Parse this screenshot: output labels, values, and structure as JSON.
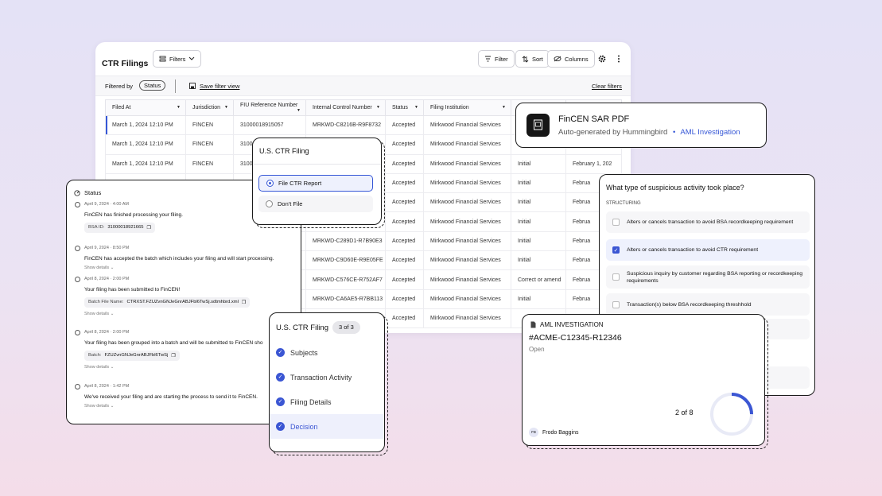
{
  "table_card": {
    "title": "CTR Filings",
    "filters_btn": "Filters",
    "filter_btn": "Filter",
    "sort_btn": "Sort",
    "columns_btn": "Columns",
    "filtered_by": "Filtered by",
    "status_pill": "Status",
    "save_view": "Save filter view",
    "clear_filters": "Clear filters",
    "columns": [
      "Filed At",
      "Jurisdiction",
      "FIU Reference Number",
      "Internal Control Number",
      "Status",
      "Filing Institution",
      "",
      ""
    ],
    "rows": [
      [
        "March 1, 2024 12:10 PM",
        "FINCEN",
        "31000018915057",
        "MRKWD-C8216B-R9F8732",
        "Accepted",
        "Mirkwood Financial Services",
        "",
        ""
      ],
      [
        "March 1, 2024 12:10 PM",
        "FINCEN",
        "3100",
        "",
        "Accepted",
        "Mirkwood Financial Services",
        "",
        ""
      ],
      [
        "March 1, 2024 12:10 PM",
        "FINCEN",
        "3100",
        "",
        "Accepted",
        "Mirkwood Financial Services",
        "Initial",
        "February 1, 202"
      ],
      [
        "",
        "",
        "",
        "",
        "Accepted",
        "Mirkwood Financial Services",
        "Initial",
        "Februa"
      ],
      [
        "",
        "",
        "",
        "",
        "Accepted",
        "Mirkwood Financial Services",
        "Initial",
        "Februa"
      ],
      [
        "",
        "",
        "",
        "",
        "Accepted",
        "Mirkwood Financial Services",
        "Initial",
        "Februa"
      ],
      [
        "",
        "",
        "",
        "MRKWD-C289D1-R7B90E3",
        "Accepted",
        "Mirkwood Financial Services",
        "Initial",
        "Februa"
      ],
      [
        "",
        "",
        "",
        "MRKWD-C9D60E-R9E05FE",
        "Accepted",
        "Mirkwood Financial Services",
        "Initial",
        "Februa"
      ],
      [
        "",
        "",
        "",
        "MRKWD-C576CE-R752AF7",
        "Accepted",
        "Mirkwood Financial Services",
        "Correct or amend",
        "Februa"
      ],
      [
        "",
        "",
        "",
        "MRKWD-CA6AE5-R7BB113",
        "Accepted",
        "Mirkwood Financial Services",
        "Initial",
        "Februa"
      ],
      [
        "",
        "",
        "",
        "",
        "Accepted",
        "Mirkwood Financial Services",
        "",
        ""
      ]
    ]
  },
  "status_card": {
    "title": "Status",
    "events": [
      {
        "date": "April 9, 2024 · 4:00 AM",
        "text": "FinCEN has finished processing your filing.",
        "chip_label": "BSA ID:",
        "chip_value": "31000018921665",
        "details": ""
      },
      {
        "date": "April 9, 2024 · 8:50 PM",
        "text": "FinCEN has accepted the batch which includes your filing and will start processing.",
        "chip_label": "",
        "chip_value": "",
        "details": "Show details"
      },
      {
        "date": "April 8, 2024 · 2:00 PM",
        "text": "Your filing has been submitted to FinCEN!",
        "chip_label": "Batch File Name:",
        "chip_value": "CTRXST.FZUZvnGNJeGnrABJFbl6TwSj.sdtmhbrd.xml",
        "details": "Show details"
      },
      {
        "date": "April 8, 2024 · 2:00 PM",
        "text": "Your filing has been grouped into a batch and will be submitted to FinCEN sho",
        "chip_label": "Batch:",
        "chip_value": "FZUZvnGNJeGnrABJFbl6TwSj",
        "details": "Show details"
      },
      {
        "date": "April 8, 2024 · 1:42 PM",
        "text": "We've received your filing and are starting the process to send it to FinCEN.",
        "chip_label": "",
        "chip_value": "",
        "details": "Show details"
      }
    ]
  },
  "ctr_popup": {
    "title": "U.S. CTR Filing",
    "option1": "File CTR Report",
    "option2": "Don't File"
  },
  "stepper": {
    "title": "U.S. CTR Filing",
    "badge": "3 of 3",
    "steps": [
      "Subjects",
      "Transaction Activity",
      "Filing Details",
      "Decision"
    ]
  },
  "fincen": {
    "title": "FinCEN SAR PDF",
    "subtitle": "Auto-generated by Hummingbird",
    "sep": "•",
    "link": "AML Investigation"
  },
  "suspicious": {
    "question": "What type of suspicious activity took place?",
    "section": "STRUCTURING",
    "options": [
      "Alters or cancels transaction to avoid BSA recordkeeping requirement",
      "Alters or cancels transaction to avoid CTR requirement",
      "Suspicious inquiry by customer regarding BSA reporting or recordkeeping requirements",
      "Transaction(s) below BSA recordkeeping threshhold"
    ],
    "checked_index": 1
  },
  "aml": {
    "label": "AML INVESTIGATION",
    "id": "#ACME-C12345-R12346",
    "state": "Open",
    "progress_text": "2 of 8",
    "progress": 0.25,
    "user_initials": "FB",
    "user_name": "Frodo Baggins"
  },
  "colors": {
    "accent": "#3b56d3",
    "link": "#3657d6"
  }
}
